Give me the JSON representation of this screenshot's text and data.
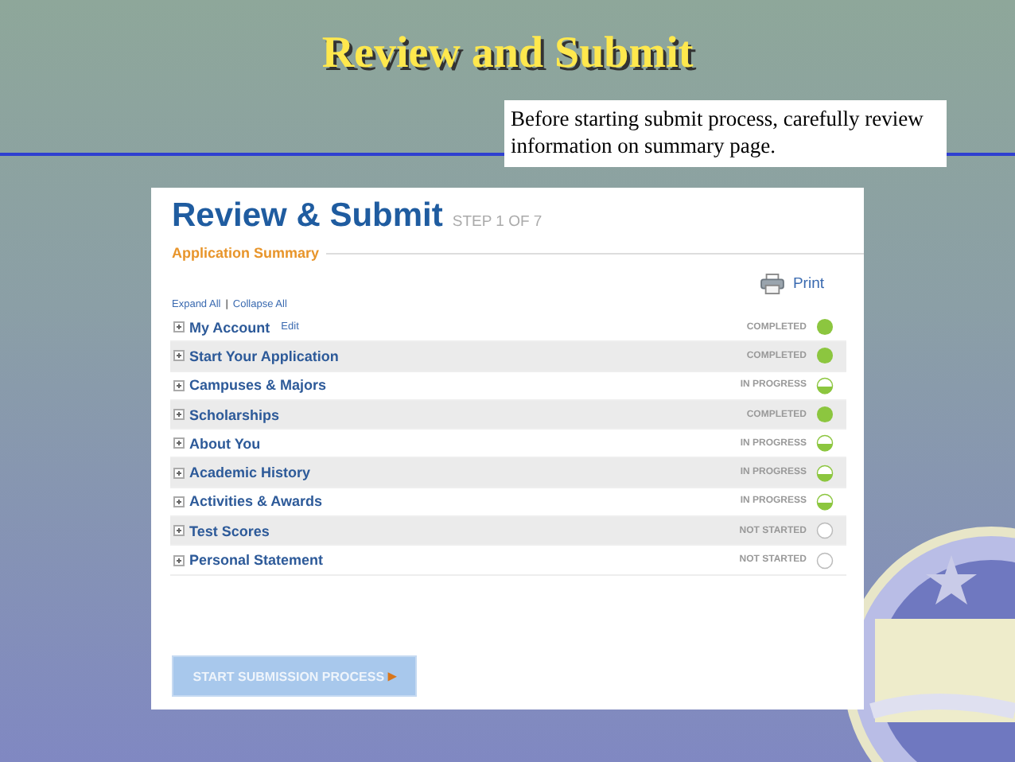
{
  "slide": {
    "title": "Review and Submit",
    "note": "Before starting submit process, carefully review information on  summary page."
  },
  "page": {
    "heading": "Review & Submit",
    "step": "STEP 1 OF 7",
    "section": "Application Summary",
    "print": "Print",
    "expand_all": "Expand All",
    "separator": "|",
    "collapse_all": "Collapse All",
    "items": [
      {
        "label": "My Account",
        "edit": "Edit",
        "status": "COMPLETED",
        "kind": "completed"
      },
      {
        "label": "Start Your Application",
        "status": "COMPLETED",
        "kind": "completed"
      },
      {
        "label": "Campuses & Majors",
        "status": "IN PROGRESS",
        "kind": "in_progress"
      },
      {
        "label": "Scholarships",
        "status": "COMPLETED",
        "kind": "completed"
      },
      {
        "label": "About You",
        "status": "IN PROGRESS",
        "kind": "in_progress"
      },
      {
        "label": "Academic History",
        "status": "IN PROGRESS",
        "kind": "in_progress"
      },
      {
        "label": "Activities & Awards",
        "status": "IN PROGRESS",
        "kind": "in_progress"
      },
      {
        "label": "Test Scores",
        "status": "NOT STARTED",
        "kind": "not_started"
      },
      {
        "label": "Personal Statement",
        "status": "NOT STARTED",
        "kind": "not_started"
      }
    ],
    "submit_button": "START SUBMISSION PROCESS",
    "submit_arrow": "▸"
  }
}
